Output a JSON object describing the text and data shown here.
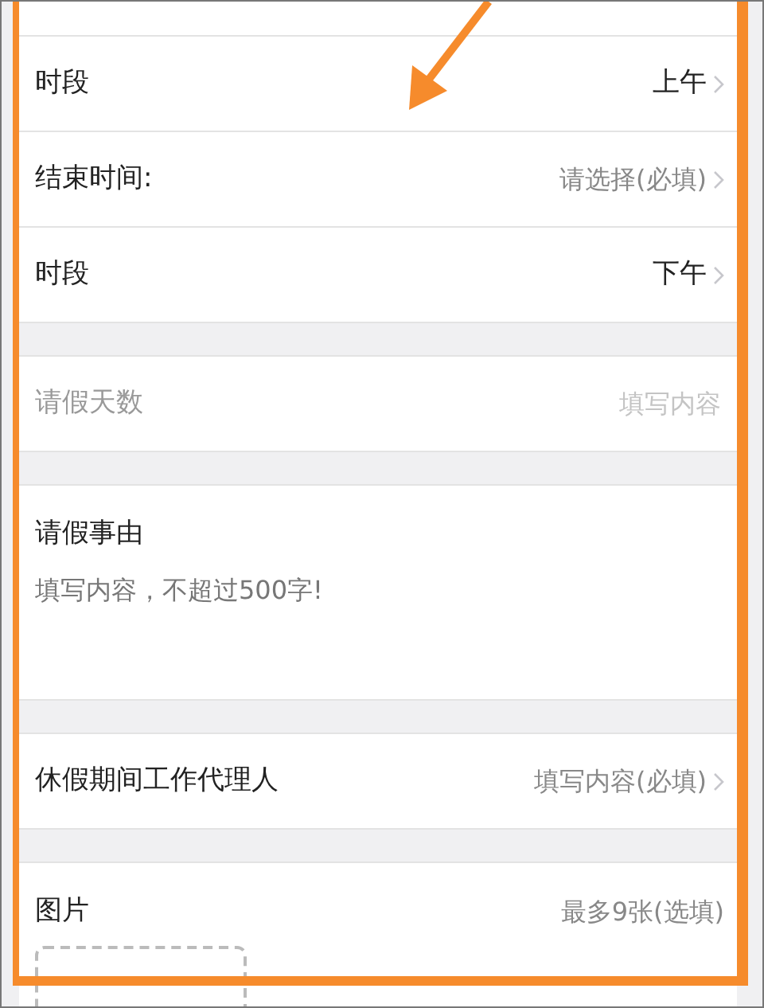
{
  "sections": [
    {
      "rows": [
        {
          "kind": "select",
          "label": "时段",
          "value": "上午",
          "filled": true
        },
        {
          "kind": "select",
          "label": "结束时间:",
          "value": "请选择(必填)",
          "filled": false
        },
        {
          "kind": "select",
          "label": "时段",
          "value": "下午",
          "filled": true
        }
      ]
    },
    {
      "rows": [
        {
          "kind": "input",
          "label": "请假天数",
          "placeholder": "填写内容"
        }
      ]
    },
    {
      "rows": [
        {
          "kind": "textarea",
          "label": "请假事由",
          "placeholder": "填写内容，不超过500字!"
        }
      ]
    },
    {
      "rows": [
        {
          "kind": "select",
          "label": "休假期间工作代理人",
          "value": "填写内容(必填)",
          "filled": false
        }
      ]
    },
    {
      "rows": [
        {
          "kind": "images",
          "label": "图片",
          "hint": "最多9张(选填)"
        }
      ]
    }
  ]
}
